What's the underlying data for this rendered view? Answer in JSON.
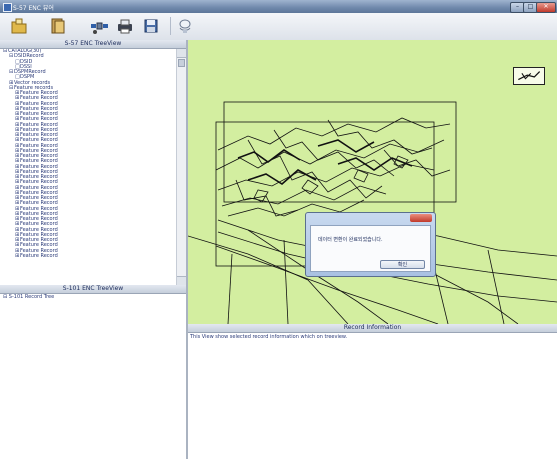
{
  "window": {
    "title": "S-57 ENC 뷰어",
    "min_label": "–",
    "max_label": "□",
    "close_label": "✕"
  },
  "toolbar": {
    "icons": [
      "open-folder-icon",
      "open-file-icon",
      "satellite-icon",
      "printer-icon",
      "save-disk-icon",
      "layer-tool-icon"
    ]
  },
  "tree": {
    "header": "S-57 ENC TreeView",
    "items": [
      {
        "label": "CATALOG(30)",
        "level": 0,
        "expander": "⊟"
      },
      {
        "label": "DSIDRecord",
        "level": 1,
        "expander": "⊟"
      },
      {
        "label": "DSID",
        "level": 2,
        "expander": "□"
      },
      {
        "label": "DSSI",
        "level": 2,
        "expander": "□"
      },
      {
        "label": "DSPMRecord",
        "level": 1,
        "expander": "⊟"
      },
      {
        "label": "DSPM",
        "level": 2,
        "expander": "□"
      },
      {
        "label": "Vector records",
        "level": 1,
        "expander": "⊞"
      },
      {
        "label": "Feature records",
        "level": 1,
        "expander": "⊟"
      },
      {
        "label": "Feature Record",
        "level": 2,
        "expander": "⊞"
      },
      {
        "label": "Feature Record",
        "level": 2,
        "expander": "⊞"
      },
      {
        "label": "Feature Record",
        "level": 2,
        "expander": "⊞"
      },
      {
        "label": "Feature Record",
        "level": 2,
        "expander": "⊞"
      },
      {
        "label": "Feature Record",
        "level": 2,
        "expander": "⊞"
      },
      {
        "label": "Feature Record",
        "level": 2,
        "expander": "⊞"
      },
      {
        "label": "Feature Record",
        "level": 2,
        "expander": "⊞"
      },
      {
        "label": "Feature Record",
        "level": 2,
        "expander": "⊞"
      },
      {
        "label": "Feature Record",
        "level": 2,
        "expander": "⊞"
      },
      {
        "label": "Feature Record",
        "level": 2,
        "expander": "⊞"
      },
      {
        "label": "Feature Record",
        "level": 2,
        "expander": "⊞"
      },
      {
        "label": "Feature Record",
        "level": 2,
        "expander": "⊞"
      },
      {
        "label": "Feature Record",
        "level": 2,
        "expander": "⊞"
      },
      {
        "label": "Feature Record",
        "level": 2,
        "expander": "⊞"
      },
      {
        "label": "Feature Record",
        "level": 2,
        "expander": "⊞"
      },
      {
        "label": "Feature Record",
        "level": 2,
        "expander": "⊞"
      },
      {
        "label": "Feature Record",
        "level": 2,
        "expander": "⊞"
      },
      {
        "label": "Feature Record",
        "level": 2,
        "expander": "⊞"
      },
      {
        "label": "Feature Record",
        "level": 2,
        "expander": "⊞"
      },
      {
        "label": "Feature Record",
        "level": 2,
        "expander": "⊞"
      },
      {
        "label": "Feature Record",
        "level": 2,
        "expander": "⊞"
      },
      {
        "label": "Feature Record",
        "level": 2,
        "expander": "⊞"
      },
      {
        "label": "Feature Record",
        "level": 2,
        "expander": "⊞"
      },
      {
        "label": "Feature Record",
        "level": 2,
        "expander": "⊞"
      },
      {
        "label": "Feature Record",
        "level": 2,
        "expander": "⊞"
      },
      {
        "label": "Feature Record",
        "level": 2,
        "expander": "⊞"
      },
      {
        "label": "Feature Record",
        "level": 2,
        "expander": "⊞"
      },
      {
        "label": "Feature Record",
        "level": 2,
        "expander": "⊞"
      },
      {
        "label": "Feature Record",
        "level": 2,
        "expander": "⊞"
      },
      {
        "label": "Feature Record",
        "level": 2,
        "expander": "⊞"
      },
      {
        "label": "Feature Record",
        "level": 2,
        "expander": "⊞"
      },
      {
        "label": "Feature Record",
        "level": 2,
        "expander": "⊞"
      }
    ]
  },
  "record_tree": {
    "header": "S-101 ENC TreeView",
    "item": "⊟ S-101 Record Tree"
  },
  "dialog": {
    "message": "데이터 변환이 완료되었습니다.",
    "ok_label": "확인"
  },
  "info": {
    "header": "Record Information",
    "text": "This View show selected record information which on treeview."
  },
  "colors": {
    "map_background": "#d3eea0",
    "chart_lines": "#111111"
  }
}
